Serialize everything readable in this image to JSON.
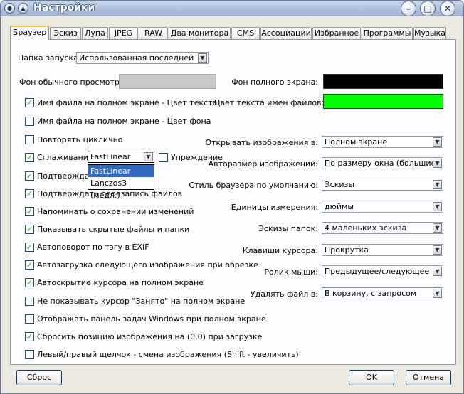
{
  "window": {
    "title": "Настройки"
  },
  "tabs": [
    {
      "label": "Браузер",
      "active": true
    },
    {
      "label": "Эскиз"
    },
    {
      "label": "Лупа"
    },
    {
      "label": "JPEG"
    },
    {
      "label": "RAW"
    },
    {
      "label": "Два монитора"
    },
    {
      "label": "CMS"
    },
    {
      "label": "Ассоциации"
    },
    {
      "label": "Избранное"
    },
    {
      "label": "Программы"
    },
    {
      "label": "Музыка"
    }
  ],
  "startup_folder": {
    "label": "Папка запуска:",
    "value": "Использованная последней"
  },
  "normal_bg": {
    "label": "Фон обычного просмотра:",
    "color": "#c8c8c8"
  },
  "fullscreen_bg": {
    "label": "Фон полного экрана:",
    "color": "#000000"
  },
  "filename_text_color": {
    "label": "Цвет текста имён файлов:",
    "color": "#00ff00"
  },
  "checkboxes": [
    {
      "label": "Имя файла на полном экране - Цвет текста",
      "checked": true
    },
    {
      "label": "Имя файла на полном экране - Цвет фона",
      "checked": false
    },
    {
      "label": "Повторять циклично",
      "checked": false
    },
    {
      "label": "Сглаживание",
      "checked": true
    },
    {
      "label": "Подтверждать",
      "checked": true
    },
    {
      "label": "Подтверждать перезапись файлов",
      "checked": true
    },
    {
      "label": "Напоминать о сохранении изменений",
      "checked": true
    },
    {
      "label": "Показывать скрытые файлы и папки",
      "checked": true
    },
    {
      "label": "Автоповорот по тэгу в EXIF",
      "checked": true
    },
    {
      "label": "Автозагрузка следующего изображения при обрезке",
      "checked": true
    },
    {
      "label": "Автоскрытие курсора на полном экране",
      "checked": true
    },
    {
      "label": "Не показывать курсор \"Занято\" на полном экране",
      "checked": false
    },
    {
      "label": "Отображать панель задач Windows при полном экране",
      "checked": false
    },
    {
      "label": "Сбросить позицию изображения на (0,0) при загрузке",
      "checked": true
    },
    {
      "label": "Левый/правый щелчок - смена изображения (Shift - увеличить)",
      "checked": false
    }
  ],
  "smoothing": {
    "value": "FastLinear",
    "options": [
      "FastLinear",
      "Lanczos3 (медл.)"
    ],
    "selected": "FastLinear"
  },
  "preload": {
    "label": "Упреждение",
    "checked": false
  },
  "right_settings": [
    {
      "label": "Открывать изображения в:",
      "value": "Полном экране"
    },
    {
      "label": "Авторазмер изображений:",
      "value": "По размеру окна (большие)"
    },
    {
      "label": "Стиль браузера по умолчанию:",
      "value": "Эскизы"
    },
    {
      "label": "Единицы измерения:",
      "value": "дюймы"
    },
    {
      "label": "Эскизы папок:",
      "value": "4 маленьких эскиза"
    },
    {
      "label": "Клавиши курсора:",
      "value": "Прокрутка"
    },
    {
      "label": "Ролик мыши:",
      "value": "Предыдущее/следующее"
    },
    {
      "label": "Удалять файл в:",
      "value": "В корзину, с запросом"
    }
  ],
  "buttons": {
    "reset": "Сброс",
    "ok": "OK",
    "cancel": "Отмена"
  },
  "icons": {
    "system": "circle-icon",
    "arrow": "chevron-down-icon",
    "check": "check-icon"
  }
}
